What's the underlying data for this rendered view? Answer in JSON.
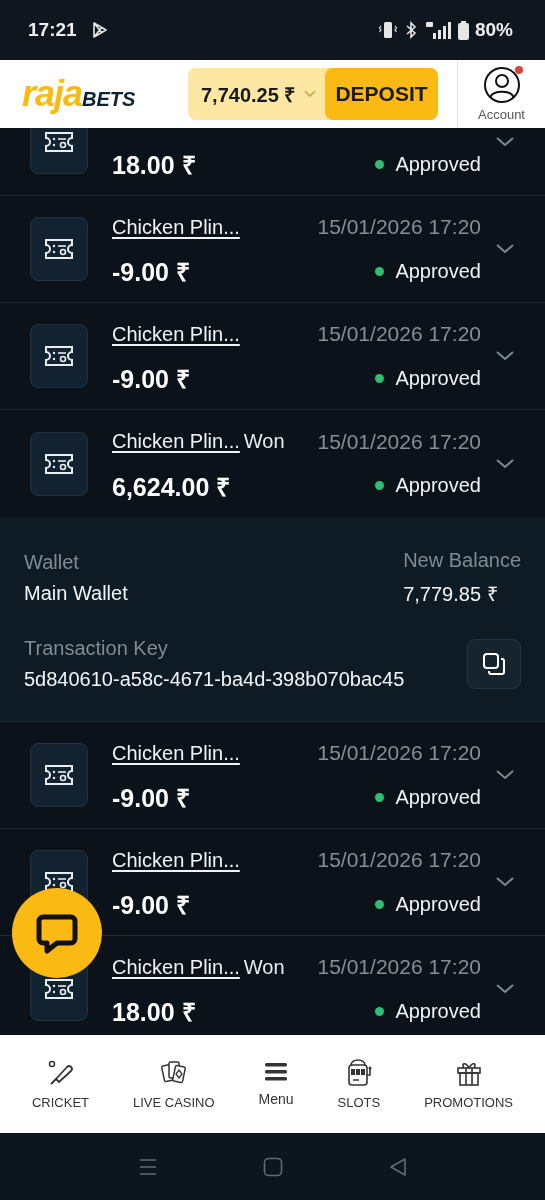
{
  "status_bar": {
    "time": "17:21",
    "battery": "80%"
  },
  "header": {
    "logo": {
      "part_1": "raja",
      "part_2": "BETS"
    },
    "balance": "7,740.25 ₹",
    "deposit": "DEPOSIT",
    "account": "Account",
    "notification": true
  },
  "transactions": [
    {
      "amount": "18.00 ₹",
      "status": "Approved",
      "color": "#2fbf71",
      "expanded": false
    },
    {
      "title": "Chicken Plin...",
      "date": "15/01/2026 17:20",
      "amount": "-9.00 ₹",
      "status": "Approved",
      "color": "#2fbf71",
      "expanded": false
    },
    {
      "title": "Chicken Plin...",
      "date": "15/01/2026 17:20",
      "amount": "-9.00 ₹",
      "status": "Approved",
      "color": "#2fbf71",
      "expanded": false
    },
    {
      "title": "Chicken Plin...",
      "suffix": "Won",
      "date": "15/01/2026 17:20",
      "amount": "6,624.00 ₹",
      "status": "Approved",
      "color": "#2fbf71",
      "expanded": true,
      "details": {
        "wallet_label": "Wallet",
        "wallet": "Main Wallet",
        "balance_label": "New Balance",
        "balance": "7,779.85 ₹",
        "key_label": "Transaction Key",
        "key": "5d840610-a58c-4671-ba4d-398b070bac45"
      }
    },
    {
      "title": "Chicken Plin...",
      "date": "15/01/2026 17:20",
      "amount": "-9.00 ₹",
      "status": "Approved",
      "color": "#2fbf71",
      "expanded": false
    },
    {
      "title": "Chicken Plin...",
      "date": "15/01/2026 17:20",
      "amount": "-9.00 ₹",
      "status": "Approved",
      "color": "#2fbf71",
      "expanded": false
    },
    {
      "title": "Chicken Plin...",
      "suffix": "Won",
      "date": "15/01/2026 17:20",
      "amount": "18.00 ₹",
      "status": "Approved",
      "color": "#2fbf71",
      "expanded": false
    }
  ],
  "bottom_nav": [
    {
      "label": "CRICKET"
    },
    {
      "label": "LIVE CASINO"
    },
    {
      "label": "Menu"
    },
    {
      "label": "SLOTS"
    },
    {
      "label": "PROMOTIONS"
    }
  ]
}
